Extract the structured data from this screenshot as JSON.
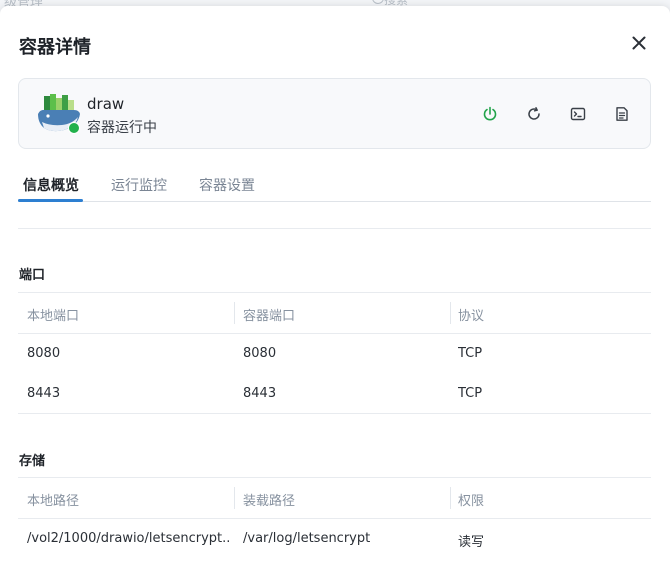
{
  "background": {
    "title_fragment": "级管理",
    "search_placeholder": "搜索"
  },
  "dialog": {
    "title": "容器详情",
    "close_icon": "close-icon"
  },
  "container": {
    "name": "draw",
    "status": "容器运行中",
    "status_color": "#22b14c",
    "actions": [
      {
        "name": "power-icon",
        "color": "#22a34a"
      },
      {
        "name": "restart-icon",
        "color": "#3a4048"
      },
      {
        "name": "terminal-icon",
        "color": "#3a4048"
      },
      {
        "name": "log-icon",
        "color": "#3a4048"
      }
    ]
  },
  "tabs": [
    {
      "label": "信息概览",
      "active": true
    },
    {
      "label": "运行监控",
      "active": false
    },
    {
      "label": "容器设置",
      "active": false
    }
  ],
  "accent_color": "#2d7fd1",
  "ports": {
    "title": "端口",
    "headers": [
      "本地端口",
      "容器端口",
      "协议"
    ],
    "rows": [
      [
        "8080",
        "8080",
        "TCP"
      ],
      [
        "8443",
        "8443",
        "TCP"
      ]
    ]
  },
  "storage": {
    "title": "存储",
    "headers": [
      "本地路径",
      "装载路径",
      "权限"
    ],
    "rows": [
      [
        "/vol2/1000/drawio/letsencrypt...",
        "/var/log/letsencrypt",
        "读写"
      ]
    ]
  }
}
